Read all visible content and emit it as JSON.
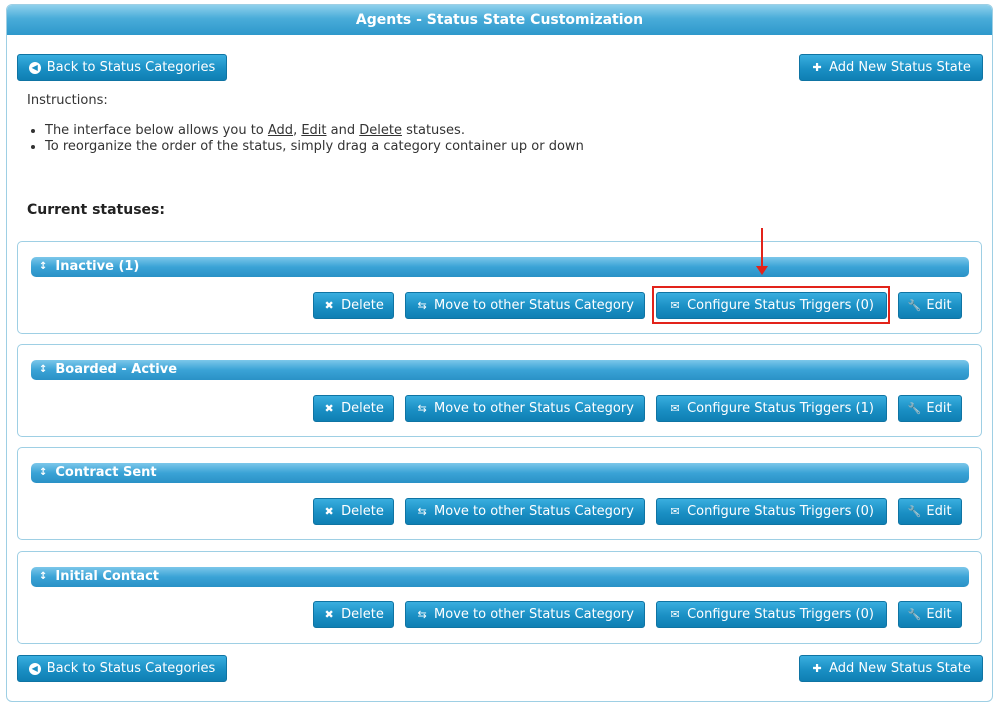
{
  "window": {
    "title": "Agents - Status State Customization"
  },
  "nav": {
    "back_label": "Back to Status Categories",
    "add_label": "Add New Status State"
  },
  "instructions": {
    "label": "Instructions:",
    "line1_prefix": "The interface below allows you to ",
    "add_word": "Add",
    "sep1": ", ",
    "edit_word": "Edit",
    "sep2": " and ",
    "delete_word": "Delete",
    "line1_suffix": " statuses.",
    "line2": "To reorganize the order of the status, simply drag a category container up or down"
  },
  "current_heading": "Current statuses:",
  "statuses": [
    {
      "name": "Inactive (1)",
      "delete": "Delete",
      "move": "Move to other Status Category",
      "triggers": "Configure Status Triggers (0)",
      "edit": "Edit"
    },
    {
      "name": "Boarded - Active",
      "delete": "Delete",
      "move": "Move to other Status Category",
      "triggers": "Configure Status Triggers (1)",
      "edit": "Edit"
    },
    {
      "name": "Contract Sent",
      "delete": "Delete",
      "move": "Move to other Status Category",
      "triggers": "Configure Status Triggers (0)",
      "edit": "Edit"
    },
    {
      "name": "Initial Contact",
      "delete": "Delete",
      "move": "Move to other Status Category",
      "triggers": "Configure Status Triggers (0)",
      "edit": "Edit"
    }
  ],
  "icons": {
    "back": "circle-left-icon",
    "add": "plus-icon",
    "grip": "drag-updown-icon",
    "delete": "close-x-icon",
    "move": "swap-arrows-icon",
    "triggers": "envelope-icon",
    "edit": "wrench-icon"
  },
  "colors": {
    "accent": "#1a8fc4",
    "highlight": "#e2231a"
  }
}
